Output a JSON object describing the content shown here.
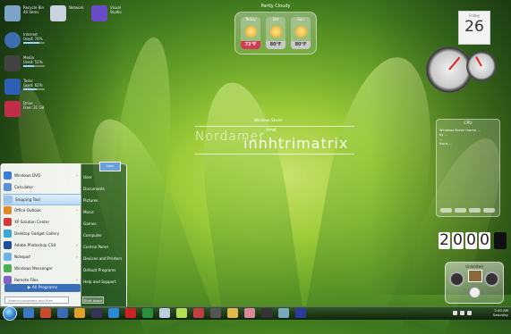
{
  "desktop": {
    "icons": [
      {
        "label": "Recycle Bin",
        "sub": "46 items",
        "color": "#7da4c8"
      },
      {
        "label": "Network",
        "sub": "",
        "color": "#c8d3df"
      },
      {
        "label": "Visual Studio",
        "sub": "",
        "color": "#6b4cc7"
      },
      {
        "label": "Internet",
        "sub": "Used: 74%",
        "color": "#3b6fb0"
      },
      {
        "label": "Media",
        "sub": "Used: 51%",
        "color": "#424242"
      },
      {
        "label": "Tasks",
        "sub": "Used: 62%",
        "color": "#2e5fb7"
      },
      {
        "label": "Drive",
        "sub": "Free: 31 GB",
        "color": "#c42d4a"
      }
    ]
  },
  "weather": {
    "title": "Partly Cloudy",
    "days": [
      {
        "label": "Today",
        "temp": "73°F",
        "current": true
      },
      {
        "label": "Sat",
        "temp": "80°F",
        "current": false
      },
      {
        "label": "Sun",
        "temp": "80°F",
        "current": false
      }
    ]
  },
  "calendar": {
    "month": "Friday",
    "day": "26"
  },
  "watermark": {
    "top": "Windows Seven",
    "left": "Nordamer",
    "main": "innhtrimatrix",
    "tiny": "tmd"
  },
  "info_panel": {
    "title": "CPU",
    "rows": [
      "Windows Seven theme ...",
      "by ...",
      "...",
      "Icons ..."
    ]
  },
  "flip_clock": {
    "digits": [
      "2",
      "0",
      "0",
      "0"
    ]
  },
  "media": {
    "label": "Unlimited"
  },
  "start_menu": {
    "user": "User",
    "left_items": [
      {
        "label": "Windows DVD",
        "color": "#3a7bd5",
        "arrow": true
      },
      {
        "label": "Calculator",
        "color": "#5b8fd3",
        "arrow": false
      },
      {
        "label": "Snipping Tool",
        "color": "#9fc3e8",
        "arrow": false,
        "highlight": true
      },
      {
        "label": "Office Outlook",
        "color": "#e08a27",
        "arrow": true
      },
      {
        "label": "XP Solution Center",
        "color": "#d23a3a",
        "arrow": false
      },
      {
        "label": "Desktop Gadget Gallery",
        "color": "#3aa7d5",
        "arrow": false
      },
      {
        "label": "Adobe Photoshop CS4",
        "color": "#1f4f99",
        "arrow": true
      },
      {
        "label": "Notepad",
        "color": "#6cb3e5",
        "arrow": true
      },
      {
        "label": "Windows Messenger",
        "color": "#4caf50",
        "arrow": false
      },
      {
        "label": "Remote Files",
        "color": "#7d62c9",
        "arrow": true
      }
    ],
    "all_programs": "All Programs",
    "right_items": [
      "User",
      "Documents",
      "Pictures",
      "Music",
      "Games",
      "Computer",
      "Control Panel",
      "Devices and Printers",
      "Default Programs",
      "Help and Support"
    ],
    "search_placeholder": "Search programs and files",
    "shutdown": "Shut down"
  },
  "taskbar": {
    "apps": [
      "#3f78c6",
      "#c94a2a",
      "#3d6bb3",
      "#e0a126",
      "#335",
      "#2a8bd8",
      "#c22",
      "#2b8e3a",
      "#bcd",
      "#b3dd55",
      "#c04040",
      "#555",
      "#e2b84a",
      "#dd8899",
      "#333",
      "#7ab",
      "#2c3c9d"
    ],
    "clock_time": "2:40 AM",
    "clock_date": "Saturday"
  }
}
